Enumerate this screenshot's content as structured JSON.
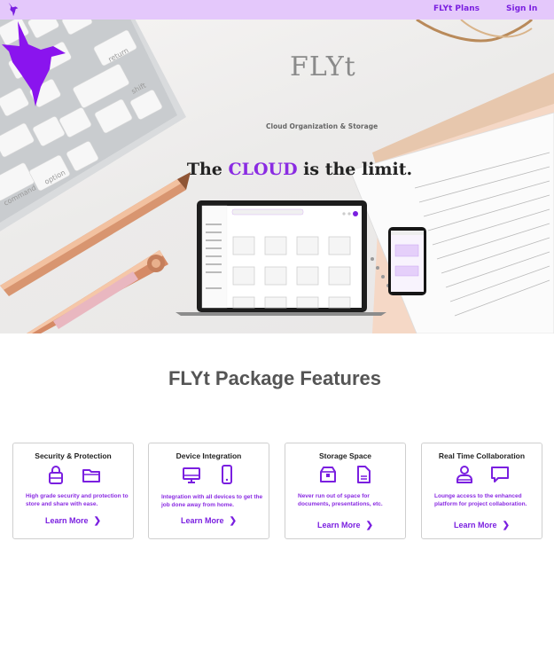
{
  "nav": {
    "logo_icon": "hummingbird-logo-icon",
    "plans_label": "FLYt Plans",
    "signin_label": "Sign In",
    "background": "#e4c8fb",
    "link_color": "#7a1fe0"
  },
  "hero": {
    "brand_name": "FLYt",
    "tagline": "Cloud Organization & Storage",
    "headline_prefix": "The ",
    "headline_highlight": "CLOUD",
    "headline_suffix": " is the limit.",
    "highlight_color": "#8a2be2"
  },
  "features": {
    "title": "FLYt Package Features",
    "cards": [
      {
        "title": "Security & Protection",
        "icons": [
          "lock-icon",
          "folder-icon"
        ],
        "description": "High grade security and protection to store and share with ease.",
        "learn_more": "Learn More"
      },
      {
        "title": "Device Integration",
        "icons": [
          "monitor-icon",
          "phone-icon"
        ],
        "description": "Integration with all devices to get the job done away from home.",
        "learn_more": "Learn More"
      },
      {
        "title": "Storage Space",
        "icons": [
          "archive-box-icon",
          "document-icon"
        ],
        "description": "Never run out of space for documents, presentations, etc.",
        "learn_more": "Learn More"
      },
      {
        "title": "Real Time Collaboration",
        "icons": [
          "person-icon",
          "chat-icon"
        ],
        "description": "Lounge access to the enhanced platform for project collaboration.",
        "learn_more": "Learn More"
      }
    ]
  }
}
